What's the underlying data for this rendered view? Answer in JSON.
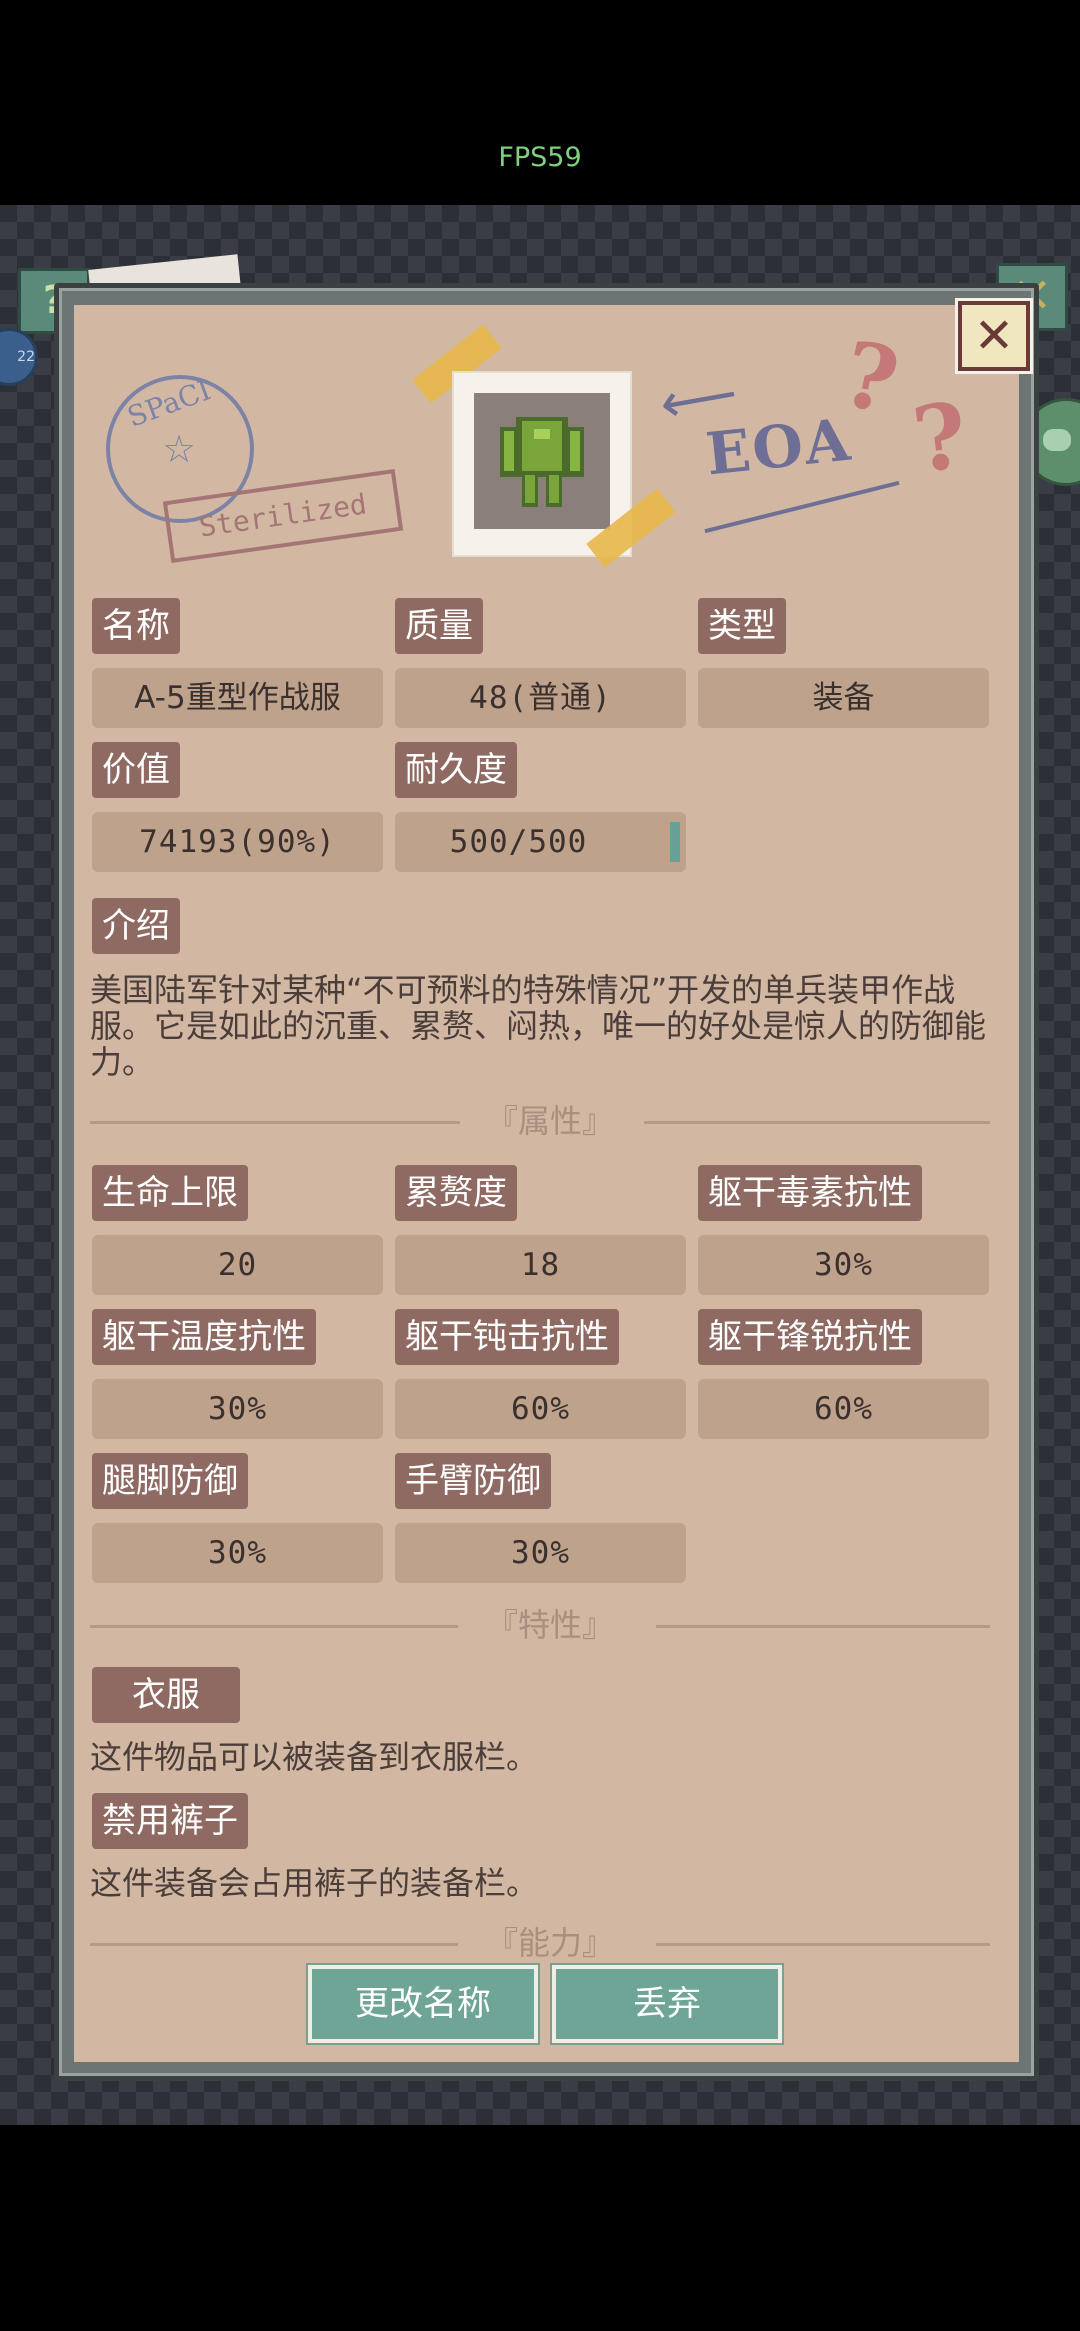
{
  "status_bar": {
    "fps": "FPS59"
  },
  "hud": {
    "help_icon": "?",
    "close_icon": "✕",
    "badge_text": "22"
  },
  "stamp": {
    "stamp_text": "SPaCI",
    "sterilized_text": "Sterilized",
    "eoa_text": "EOA"
  },
  "item": {
    "icon_name": "armor-suit-icon",
    "name_label": "名称",
    "name_value": "A-5重型作战服",
    "quality_label": "质量",
    "quality_value": "48(普通)",
    "type_label": "类型",
    "type_value": "装备",
    "value_label": "价值",
    "value_value": "74193(90%)",
    "durability_label": "耐久度",
    "durability_value": "500/500",
    "durability_fill": 1.0,
    "intro_label": "介绍",
    "intro_text": "美国陆军针对某种“不可预料的特殊情况”开发的单兵装甲作战服。它是如此的沉重、累赘、闷热，唯一的好处是惊人的防御能力。"
  },
  "attributes": {
    "section_title": "『属性』",
    "items": [
      {
        "label": "生命上限",
        "value": "20"
      },
      {
        "label": "累赘度",
        "value": "18"
      },
      {
        "label": "躯干毒素抗性",
        "value": "30%"
      },
      {
        "label": "躯干温度抗性",
        "value": "30%"
      },
      {
        "label": "躯干钝击抗性",
        "value": "60%"
      },
      {
        "label": "躯干锋锐抗性",
        "value": "60%"
      },
      {
        "label": "腿脚防御",
        "value": "30%"
      },
      {
        "label": "手臂防御",
        "value": "30%"
      }
    ]
  },
  "traits": {
    "section_title": "『特性』",
    "items": [
      {
        "label": "衣服",
        "desc": "这件物品可以被装备到衣服栏。"
      },
      {
        "label": "禁用裤子",
        "desc": "这件装备会占用裤子的装备栏。"
      }
    ]
  },
  "abilities": {
    "section_title": "『能力』"
  },
  "actions": {
    "rename": "更改名称",
    "discard": "丢弃"
  },
  "colors": {
    "panel": "#d2b8a2",
    "label_bg": "#8f6a63",
    "value_bg": "#bfa28c",
    "button": "#6ea596"
  }
}
